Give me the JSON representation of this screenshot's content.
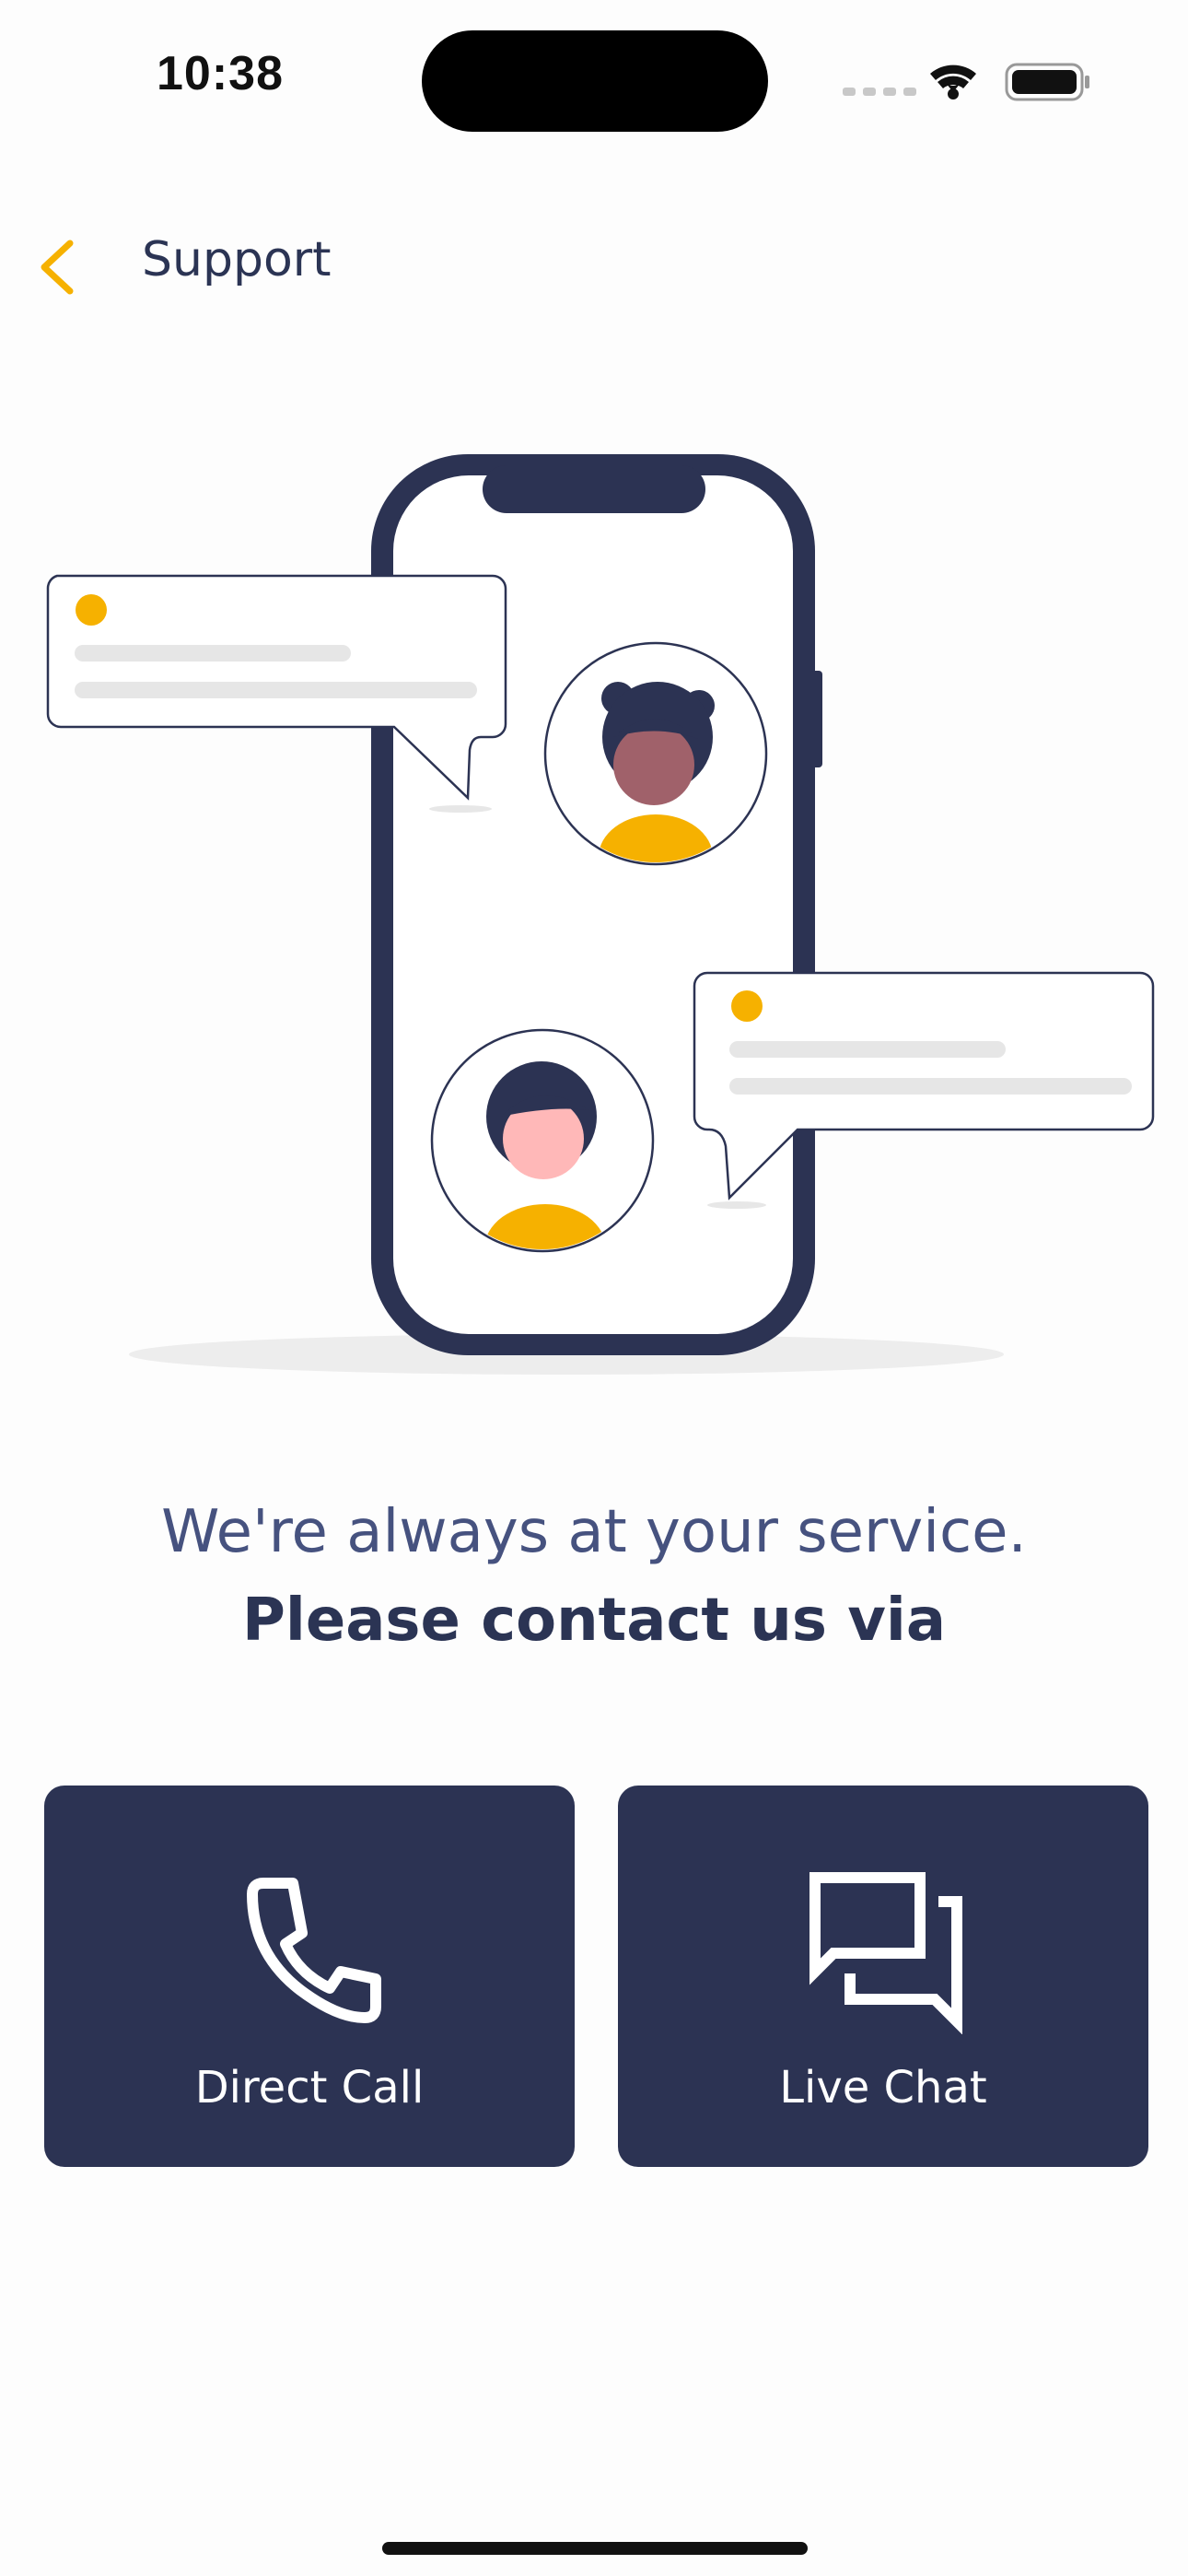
{
  "status_bar": {
    "time": "10:38",
    "icons": [
      "cellular-signal-icon",
      "wifi-icon",
      "battery-icon"
    ]
  },
  "nav": {
    "back_icon": "chevron-left-icon",
    "title": "Support"
  },
  "hero": {
    "line1": "We're always at your service.",
    "line2": "Please contact us via"
  },
  "actions": {
    "direct_call": {
      "label": "Direct Call",
      "icon": "phone-icon"
    },
    "live_chat": {
      "label": "Live Chat",
      "icon": "chat-bubbles-icon"
    }
  },
  "colors": {
    "accent": "#f6b100",
    "navy": "#2c3353",
    "heading": "#46527f"
  }
}
